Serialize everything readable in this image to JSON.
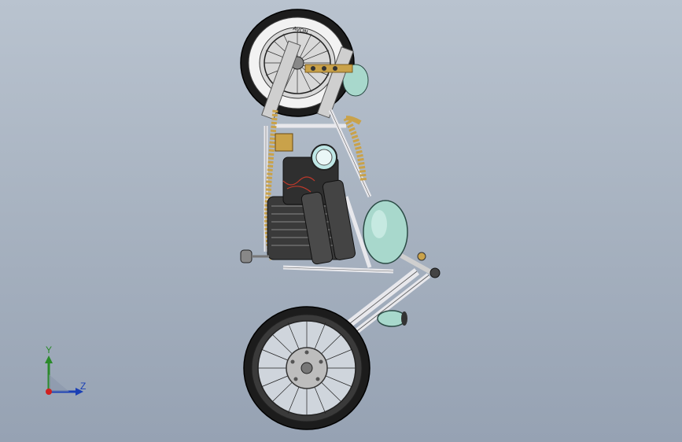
{
  "viewport": {
    "background_top": "#b9c3cf",
    "background_bottom": "#96a2b3"
  },
  "model": {
    "tire_brand_text": "AVON",
    "colors": {
      "tire": "#1c1c1c",
      "whitewall": "#f2f2f2",
      "frame": "#e8e8ec",
      "tank": "#a8d8cc",
      "brass": "#c9a24a",
      "engine": "#3a3a3a",
      "wires": "#c0392b"
    }
  },
  "triad": {
    "y_label": "Y",
    "z_label": "Z",
    "y_color": "#2a8a2a",
    "z_color": "#1a3fb5",
    "origin_color": "#d02020",
    "icon": "coordinate-triad-icon"
  }
}
